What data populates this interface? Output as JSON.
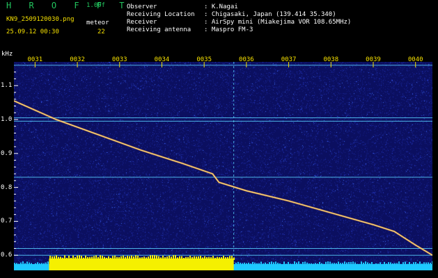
{
  "header": {
    "brand": "H R O F F T",
    "version": "1.00f",
    "filename": "KN9_2509120030.png",
    "meteor_label": "meteor",
    "datetime": "25.09.12 00:30",
    "count": "22"
  },
  "info": [
    {
      "key": "Observer",
      "value": ": K.Nagai"
    },
    {
      "key": "Receiving Location",
      "value": ": Chigasaki, Japan (139.414 35.340)"
    },
    {
      "key": "Receiver",
      "value": ": AirSpy mini (Miakejima VOR 108.65MHz)"
    },
    {
      "key": "Receiving antenna",
      "value": ": Maspro FM-3"
    }
  ],
  "chart_data": {
    "type": "heatmap",
    "ylabel": "kHz",
    "x_ticks": [
      "0031",
      "0032",
      "0033",
      "0034",
      "0035",
      "0036",
      "0037",
      "0038",
      "0039",
      "0040"
    ],
    "y_ticks": [
      "1.1",
      "1.0",
      "0.9",
      "0.8",
      "0.7",
      "0.6"
    ],
    "ylim": [
      0.58,
      1.17
    ],
    "xlim_minutes": [
      30.5,
      40.4
    ],
    "horizontal_lines_khz": [
      1.16,
      1.005,
      0.995,
      0.83,
      0.62,
      0.6
    ],
    "vertical_line_minute": 35.7,
    "meteor_trail": [
      {
        "x": 30.5,
        "y": 1.055
      },
      {
        "x": 31.5,
        "y": 1.0
      },
      {
        "x": 32.5,
        "y": 0.955
      },
      {
        "x": 33.5,
        "y": 0.91
      },
      {
        "x": 34.5,
        "y": 0.87
      },
      {
        "x": 35.2,
        "y": 0.84
      },
      {
        "x": 35.35,
        "y": 0.815
      },
      {
        "x": 36.0,
        "y": 0.79
      },
      {
        "x": 37.0,
        "y": 0.76
      },
      {
        "x": 38.0,
        "y": 0.725
      },
      {
        "x": 39.0,
        "y": 0.69
      },
      {
        "x": 39.5,
        "y": 0.67
      },
      {
        "x": 40.0,
        "y": 0.63
      },
      {
        "x": 40.4,
        "y": 0.6
      }
    ],
    "colors": {
      "background": "#0b0f60",
      "noise": "#1c2ec8",
      "trail": "#ffe27a",
      "line": "#5ad3ff",
      "axis_text": "#f5e000",
      "bottom_cyan": "#1ec8ff",
      "bottom_yellow": "#f5f000"
    }
  }
}
